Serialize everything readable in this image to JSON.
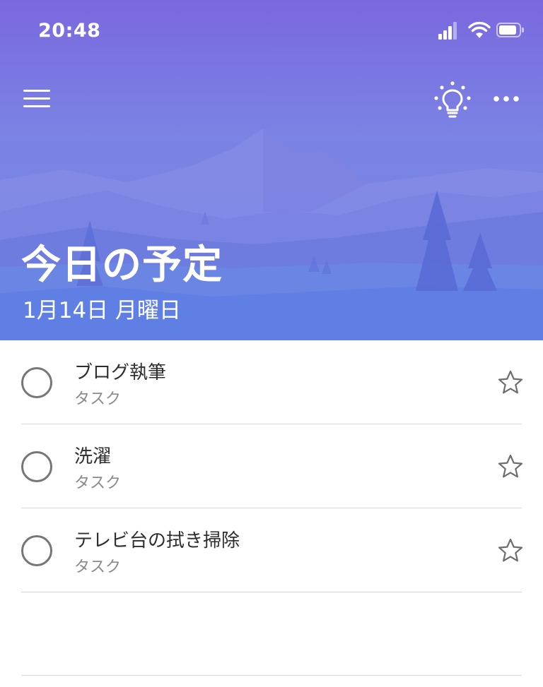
{
  "status_bar": {
    "time": "20:48",
    "icons": [
      "signal-icon",
      "wifi-icon",
      "battery-icon"
    ]
  },
  "toolbar": {
    "menu_icon": "hamburger-menu-icon",
    "suggestions_icon": "lightbulb-icon",
    "more_icon": "more-dots-icon"
  },
  "header": {
    "title": "今日の予定",
    "date": "1月14日 月曜日"
  },
  "tasks": [
    {
      "title": "ブログ執筆",
      "list": "タスク",
      "completed": false,
      "important": false
    },
    {
      "title": "洗濯",
      "list": "タスク",
      "completed": false,
      "important": false
    },
    {
      "title": "テレビ台の拭き掃除",
      "list": "タスク",
      "completed": false,
      "important": false
    }
  ],
  "colors": {
    "header_top": "#7a68df",
    "header_bottom": "#6f86e8",
    "circle": "#767676",
    "star": "#6d6d6d",
    "divider": "#d6d6d6"
  }
}
